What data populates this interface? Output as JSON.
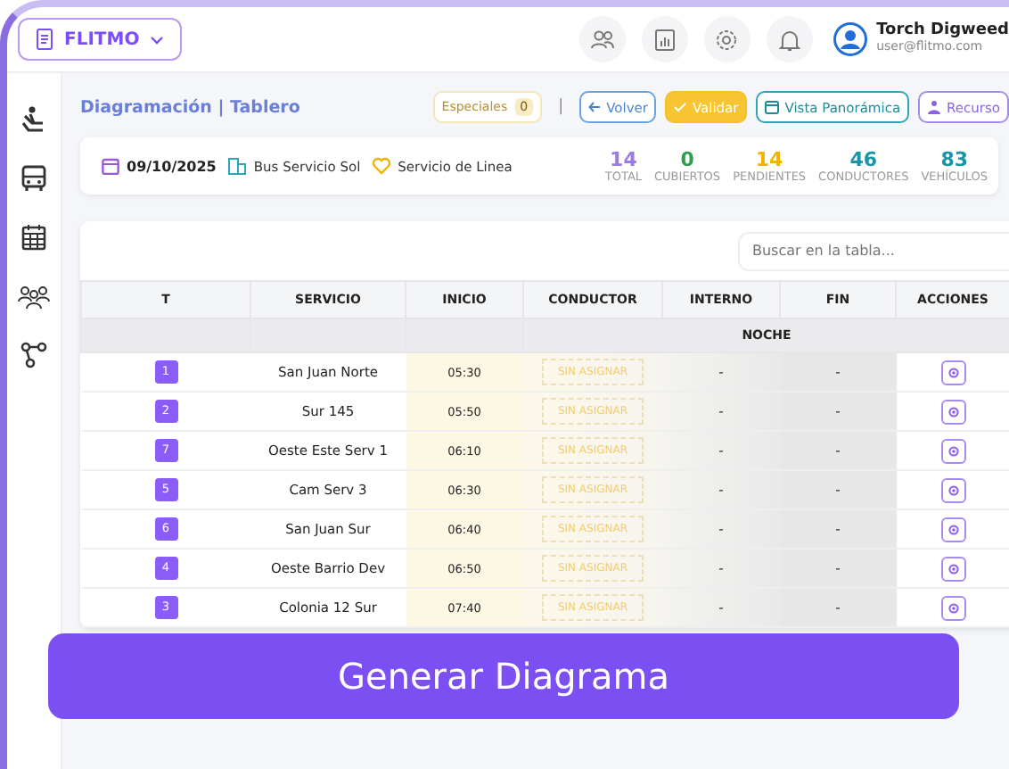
{
  "brand": {
    "label": "FLITMO"
  },
  "user": {
    "name": "Torch Digweed",
    "email": "user@flitmo.com"
  },
  "page_title": "Diagramación | Tablero",
  "especiales": {
    "label": "Especiales",
    "count": "0"
  },
  "separator": "|",
  "buttons": [
    {
      "label": "Volver",
      "kind": "back"
    },
    {
      "label": "Validar",
      "kind": "validate"
    },
    {
      "label": "Vista Panorámica",
      "kind": "overview"
    },
    {
      "label": "Recurso",
      "kind": "resources"
    }
  ],
  "info": {
    "date": "09/10/2025",
    "company": "Bus Servicio Sol",
    "service_type": "Servicio de Linea"
  },
  "stats": [
    {
      "value": "14",
      "label": "TOTAL",
      "color": "#9b7be0"
    },
    {
      "value": "0",
      "label": "CUBIERTOS",
      "color": "#2e9e4f"
    },
    {
      "value": "14",
      "label": "PENDIENTES",
      "color": "#f0b400"
    },
    {
      "value": "46",
      "label": "CONDUCTORES",
      "color": "#1a95a6"
    },
    {
      "value": "83",
      "label": "VEHÍCULOS",
      "color": "#1a95a6"
    }
  ],
  "table": {
    "search": {
      "placeholder": "Buscar en la tabla..."
    },
    "columns": [
      "T",
      "SERVICIO",
      "INICIO",
      "CONDUCTOR",
      "INTERNO",
      "FIN",
      "ACCIONES"
    ],
    "group_label": "NOCHE",
    "rows": [
      {
        "t": "1",
        "servicio": "San Juan Norte",
        "inicio": "05:30",
        "conductor": "SIN ASIGNAR",
        "interno": "-",
        "fin": "-"
      },
      {
        "t": "2",
        "servicio": "Sur 145",
        "inicio": "05:50",
        "conductor": "SIN ASIGNAR",
        "interno": "-",
        "fin": "-"
      },
      {
        "t": "7",
        "servicio": "Oeste Este Serv 1",
        "inicio": "06:10",
        "conductor": "SIN ASIGNAR",
        "interno": "-",
        "fin": "-"
      },
      {
        "t": "5",
        "servicio": "Cam Serv 3",
        "inicio": "06:30",
        "conductor": "SIN ASIGNAR",
        "interno": "-",
        "fin": "-"
      },
      {
        "t": "6",
        "servicio": "San Juan Sur",
        "inicio": "06:40",
        "conductor": "SIN ASIGNAR",
        "interno": "-",
        "fin": "-"
      },
      {
        "t": "4",
        "servicio": "Oeste Barrio Dev",
        "inicio": "06:50",
        "conductor": "SIN ASIGNAR",
        "interno": "-",
        "fin": "-"
      },
      {
        "t": "3",
        "servicio": "Colonia 12 Sur",
        "inicio": "07:40",
        "conductor": "SIN ASIGNAR",
        "interno": "-",
        "fin": "-"
      }
    ]
  },
  "banner": {
    "label": "Generar Diagrama"
  }
}
